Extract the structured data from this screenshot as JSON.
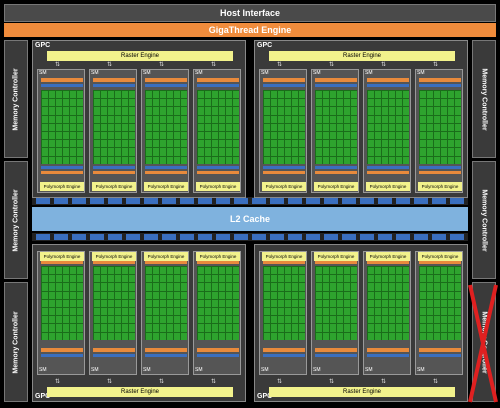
{
  "host_interface": "Host Interface",
  "gigathread_engine": "GigaThread Engine",
  "l2_cache": "L2 Cache",
  "memory_controller": "Memory Controller",
  "gpc_label": "GPC",
  "raster_engine": "Raster Engine",
  "polymorph_engine": "Polymorph Engine",
  "sm_label": "SM",
  "colors": {
    "background": "#000000",
    "host_bar": "#4a4a4a",
    "gigathread": "#f08c3c",
    "l2_cache": "#7fb2de",
    "gpc_panel": "#3a3a3a",
    "raster": "#f2f28c",
    "sm_core": "#2ea32e",
    "sm_register": "#e88a3c",
    "sm_blue": "#3a6fbf",
    "disabled_cross": "#e02020"
  },
  "disabled": {
    "sm": "bottom-right GPC, SM 4",
    "memory_controller": "right side, bottom"
  }
}
